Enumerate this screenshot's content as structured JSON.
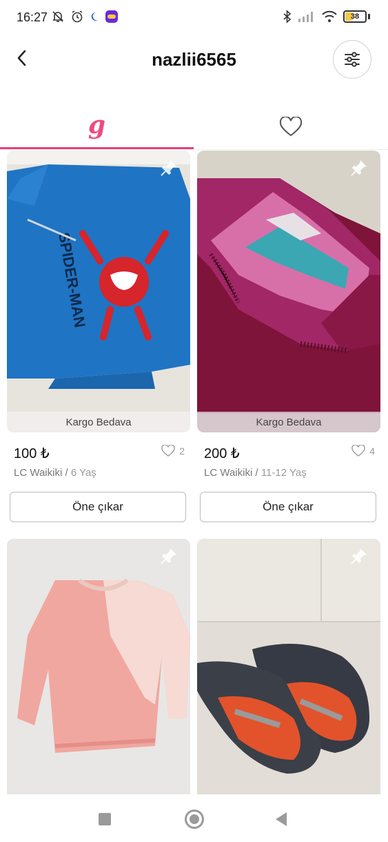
{
  "status_bar": {
    "time": "16:27",
    "battery": "38",
    "battery_level": 0.38,
    "icons_left": [
      "mute-bell-icon",
      "alarm-icon",
      "moon-icon",
      "app-badge-icon"
    ],
    "icons_right": [
      "bluetooth-icon",
      "signal-icon",
      "wifi-icon",
      "battery-icon"
    ]
  },
  "header": {
    "title": "nazlii6565",
    "back_icon": "back-arrow-icon",
    "filter_icon": "filter-sliders-icon"
  },
  "tabs": [
    {
      "glyph": "g",
      "icon": "closet-logo-icon",
      "active": true
    },
    {
      "icon": "heart-outline-icon",
      "active": false
    }
  ],
  "accent_color": "#ee3e7b",
  "products": [
    {
      "badge": "Kargo Bedava",
      "price": "100 ₺",
      "likes": "2",
      "brand": "LC Waikiki",
      "separator": " / ",
      "size": "6 Yaş",
      "action": "Öne çıkar"
    },
    {
      "badge": "Kargo Bedava",
      "price": "200 ₺",
      "likes": "4",
      "brand": "LC Waikiki",
      "separator": " / ",
      "size": "11-12 Yaş",
      "action": "Öne çıkar"
    },
    {
      "badge": "",
      "price": "",
      "likes": "",
      "brand": "",
      "separator": "",
      "size": "",
      "action": ""
    },
    {
      "badge": "",
      "price": "",
      "likes": "",
      "brand": "",
      "separator": "",
      "size": "",
      "action": ""
    }
  ],
  "nav_bar": {
    "icons": [
      "recents-square-icon",
      "home-circle-icon",
      "back-triangle-icon"
    ]
  }
}
